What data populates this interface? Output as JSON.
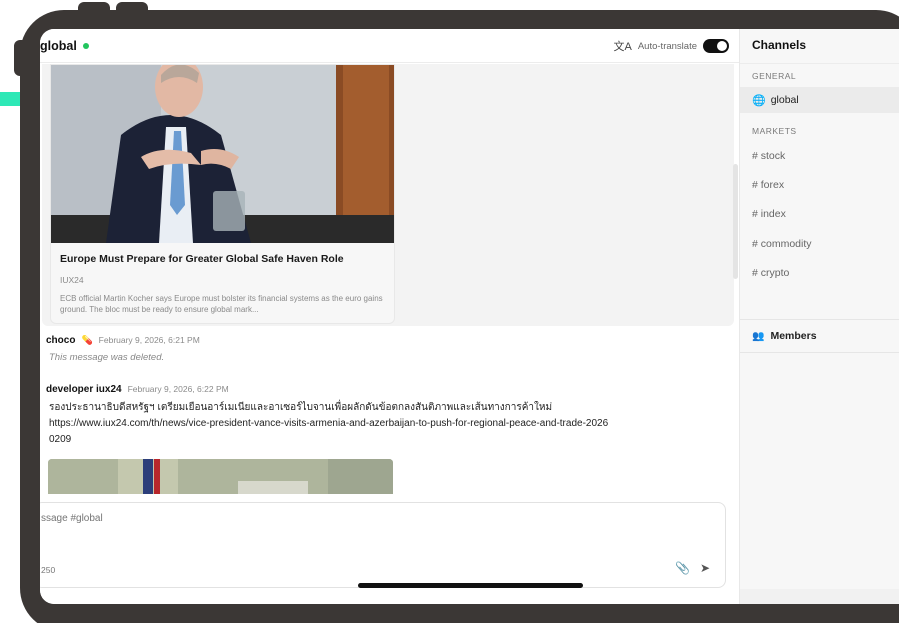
{
  "chat": {
    "channel_title": "global",
    "auto_translate_label": "Auto-translate",
    "auto_translate_on": true
  },
  "news_card": {
    "title": "Europe Must Prepare for Greater Global Safe Haven Role",
    "source": "IUX24",
    "description": "ECB official Martin Kocher says Europe must bolster its financial systems as the euro gains ground. The bloc must be ready to ensure global mark..."
  },
  "messages": [
    {
      "author": "choco",
      "badge_icon": "pill-icon",
      "time": "February 9, 2026, 6:21 PM",
      "text": "This message was deleted."
    },
    {
      "author": "developer iux24",
      "time": "February 9, 2026, 6:22 PM",
      "text_line1": "รองประธานาธิบดีสหรัฐฯ เตรียมเยือนอาร์เมเนียและอาเซอร์ไบจานเพื่อผลักดันข้อตกลงสันติภาพและเส้นทางการค้าใหม่",
      "text_line2": "https://www.iux24.com/th/news/vice-president-vance-visits-armenia-and-azerbaijan-to-push-for-regional-peace-and-trade-2026",
      "text_line3": "0209"
    }
  ],
  "composer": {
    "placeholder": "ssage #global",
    "char_count": "250"
  },
  "sidebar": {
    "title": "Channels",
    "sections": [
      {
        "label": "GENERAL",
        "items": [
          {
            "label": "global",
            "icon": "globe-icon",
            "active": true
          }
        ]
      },
      {
        "label": "MARKETS",
        "items": [
          {
            "label": "# stock"
          },
          {
            "label": "# forex"
          },
          {
            "label": "# index"
          },
          {
            "label": "# commodity"
          },
          {
            "label": "# crypto"
          }
        ]
      }
    ],
    "members_label": "Members"
  },
  "colors": {
    "online": "#22c55e",
    "accent": "#2ee8b6",
    "frame": "#3b3735"
  }
}
